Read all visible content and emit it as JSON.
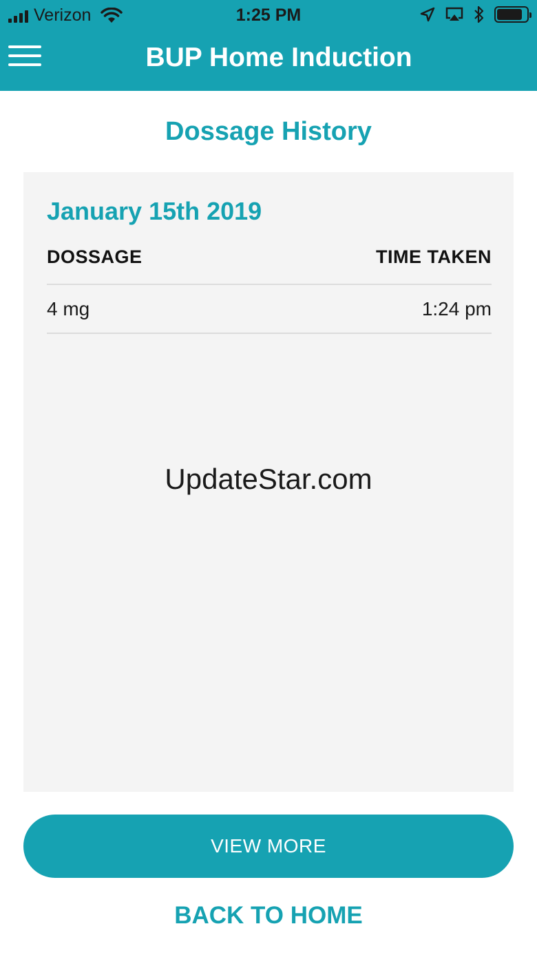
{
  "status_bar": {
    "carrier": "Verizon",
    "time": "1:25 PM",
    "icons": [
      "signal-icon",
      "wifi-icon",
      "location-icon",
      "airplay-icon",
      "bluetooth-icon",
      "battery-icon"
    ],
    "battery_level": 0.85
  },
  "header": {
    "title": "BUP Home Induction",
    "menu_icon": "hamburger-menu-icon"
  },
  "page": {
    "title": "Dossage History"
  },
  "history": {
    "date": "January 15th 2019",
    "columns": [
      "DOSSAGE",
      "TIME TAKEN"
    ],
    "rows": [
      {
        "dosage": "4 mg",
        "time": "1:24 pm"
      }
    ]
  },
  "watermark": "UpdateStar.com",
  "actions": {
    "view_more": "VIEW MORE",
    "back_to_home": "BACK TO HOME"
  },
  "colors": {
    "accent": "#16a2b2",
    "card_bg": "#f4f4f4",
    "divider": "#dcdcdc"
  }
}
